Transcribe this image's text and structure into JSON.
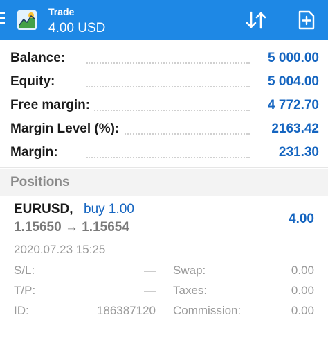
{
  "header": {
    "title": "Trade",
    "subtitle": "4.00 USD"
  },
  "colors": {
    "accent": "#1e88e5",
    "value_blue": "#1565c0",
    "muted": "#9a9a9a"
  },
  "icons": {
    "menu": "menu-icon",
    "logo": "app-logo-icon",
    "sort": "sort-icon",
    "new_order": "new-order-icon"
  },
  "account": {
    "balance": {
      "label": "Balance:",
      "value": "5 000.00"
    },
    "equity": {
      "label": "Equity:",
      "value": "5 004.00"
    },
    "free_margin": {
      "label": "Free margin:",
      "value": "4 772.70"
    },
    "margin_level": {
      "label": "Margin Level (%):",
      "value": "2163.42"
    },
    "margin": {
      "label": "Margin:",
      "value": "231.30"
    }
  },
  "positions": {
    "header": "Positions",
    "items": [
      {
        "symbol": "EURUSD,",
        "side": "buy 1.00",
        "prices": "1.15650 → 1.15654",
        "profit": "4.00",
        "time": "2020.07.23 15:25",
        "sl_label": "S/L:",
        "sl_value": "—",
        "tp_label": "T/P:",
        "tp_value": "—",
        "id_label": "ID:",
        "id_value": "186387120",
        "swap_label": "Swap:",
        "swap_value": "0.00",
        "taxes_label": "Taxes:",
        "taxes_value": "0.00",
        "commission_label": "Commission:",
        "commission_value": "0.00"
      }
    ]
  }
}
